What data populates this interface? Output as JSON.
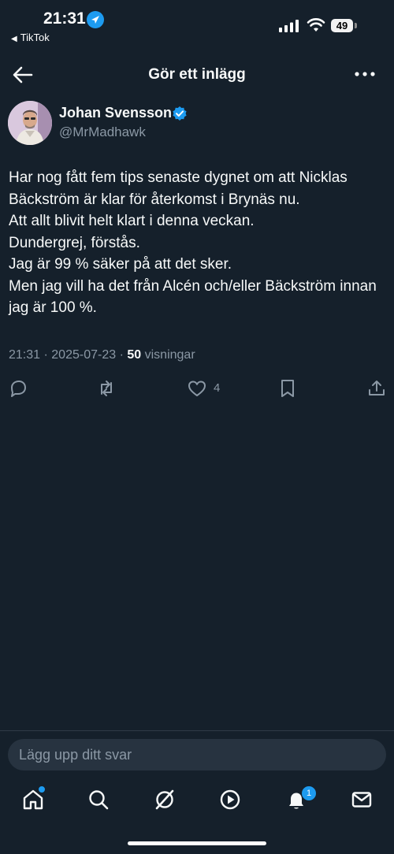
{
  "status_bar": {
    "time": "21:31",
    "back_app": "TikTok",
    "battery": "49"
  },
  "nav": {
    "title": "Gör ett inlägg"
  },
  "author": {
    "name": "Johan Svensson",
    "handle": "@MrMadhawk",
    "verified": true
  },
  "tweet": {
    "lines": [
      "Har nog fått fem tips senaste dygnet om att Nicklas Bäckström är klar för återkomst i Brynäs nu.",
      "Att allt blivit helt klart i denna veckan.",
      "Dundergrej, förstås.",
      "Jag är 99 % säker på att det sker.",
      "Men jag vill ha det från Alcén och/eller Bäckström innan jag är 100 %."
    ],
    "time": "21:31",
    "date": "2025-07-23",
    "views_count": "50",
    "views_label": "visningar"
  },
  "actions": {
    "like_count": "4"
  },
  "reply": {
    "placeholder": "Lägg upp ditt svar"
  },
  "tab_bar": {
    "notifications_badge": "1"
  },
  "colors": {
    "background": "#15202b",
    "accent": "#1d9bf0",
    "muted": "#8b98a5"
  }
}
